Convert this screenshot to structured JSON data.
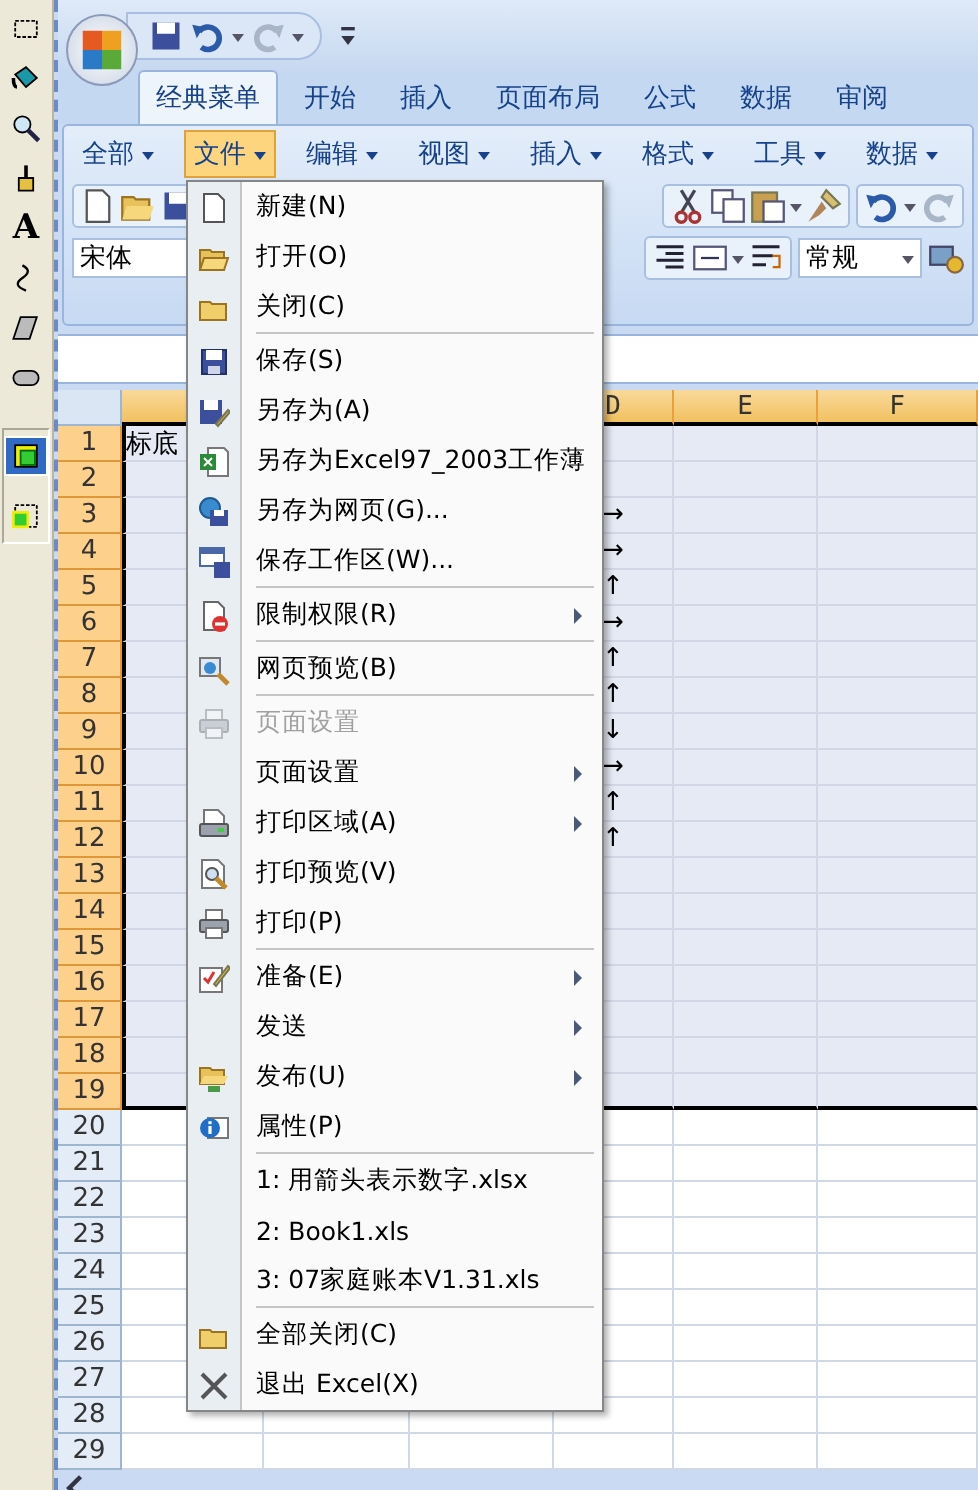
{
  "toolbox": {
    "tools": [
      {
        "kind": "select",
        "selected": false
      },
      {
        "kind": "fill",
        "selected": false
      },
      {
        "kind": "zoom",
        "selected": false
      },
      {
        "kind": "brush",
        "selected": false
      },
      {
        "kind": "text",
        "label": "A",
        "selected": false
      },
      {
        "kind": "curve",
        "selected": false
      },
      {
        "kind": "slant",
        "selected": false
      },
      {
        "kind": "rounded",
        "selected": false
      },
      {
        "kind": "object",
        "selected": true
      },
      {
        "kind": "object-dashed",
        "selected": false
      }
    ]
  },
  "tabs": [
    {
      "label": "经典菜单",
      "selected": true
    },
    {
      "label": "开始",
      "selected": false
    },
    {
      "label": "插入",
      "selected": false
    },
    {
      "label": "页面布局",
      "selected": false
    },
    {
      "label": "公式",
      "selected": false
    },
    {
      "label": "数据",
      "selected": false
    },
    {
      "label": "审阅",
      "selected": false
    }
  ],
  "menubar": [
    {
      "label": "全部",
      "selected": false
    },
    {
      "label": "文件",
      "selected": true
    },
    {
      "label": "编辑",
      "selected": false
    },
    {
      "label": "视图",
      "selected": false
    },
    {
      "label": "插入",
      "selected": false
    },
    {
      "label": "格式",
      "selected": false
    },
    {
      "label": "工具",
      "selected": false
    },
    {
      "label": "数据",
      "selected": false
    }
  ],
  "font_box": {
    "value": "宋体"
  },
  "number_format": {
    "value": "常规"
  },
  "sheet": {
    "columns": [
      {
        "label": "D",
        "selected": true
      },
      {
        "label": "E",
        "selected": true
      },
      {
        "label": "F",
        "selected": true
      }
    ],
    "rows": [
      {
        "number": "1",
        "selected": true,
        "a": "标底"
      },
      {
        "number": "2",
        "selected": true
      },
      {
        "number": "3",
        "selected": true,
        "d": "→"
      },
      {
        "number": "4",
        "selected": true,
        "d": "→"
      },
      {
        "number": "5",
        "selected": true,
        "d": "↑"
      },
      {
        "number": "6",
        "selected": true,
        "d": "→"
      },
      {
        "number": "7",
        "selected": true,
        "d": "↑"
      },
      {
        "number": "8",
        "selected": true,
        "d": "↑"
      },
      {
        "number": "9",
        "selected": true,
        "d": "↓"
      },
      {
        "number": "10",
        "selected": true,
        "d": "→"
      },
      {
        "number": "11",
        "selected": true,
        "d": "↑"
      },
      {
        "number": "12",
        "selected": true,
        "d": "↑"
      },
      {
        "number": "13",
        "selected": true
      },
      {
        "number": "14",
        "selected": true
      },
      {
        "number": "15",
        "selected": true
      },
      {
        "number": "16",
        "selected": true
      },
      {
        "number": "17",
        "selected": true
      },
      {
        "number": "18",
        "selected": true
      },
      {
        "number": "19",
        "selected": true
      },
      {
        "number": "20",
        "selected": false
      },
      {
        "number": "21",
        "selected": false
      },
      {
        "number": "22",
        "selected": false
      },
      {
        "number": "23",
        "selected": false
      },
      {
        "number": "24",
        "selected": false
      },
      {
        "number": "25",
        "selected": false
      },
      {
        "number": "26",
        "selected": false
      },
      {
        "number": "27",
        "selected": false
      },
      {
        "number": "28",
        "selected": false
      },
      {
        "number": "29",
        "selected": false
      }
    ]
  },
  "file_menu": {
    "items": [
      {
        "kind": "document",
        "label": "新建(N)",
        "disabled": false,
        "submenu": false
      },
      {
        "kind": "folder-open",
        "label": "打开(O)",
        "disabled": false,
        "submenu": false
      },
      {
        "kind": "folder",
        "label": "关闭(C)",
        "disabled": false,
        "submenu": false
      },
      {
        "kind": "separator"
      },
      {
        "kind": "floppy",
        "label": "保存(S)",
        "disabled": false,
        "submenu": false
      },
      {
        "kind": "floppy-pen",
        "label": "另存为(A)",
        "disabled": false,
        "submenu": false
      },
      {
        "kind": "sheet-doc",
        "label": "另存为Excel97_2003工作薄",
        "disabled": false,
        "submenu": false
      },
      {
        "kind": "globe-floppy",
        "label": "另存为网页(G)...",
        "disabled": false,
        "submenu": false
      },
      {
        "kind": "window-floppy",
        "label": "保存工作区(W)...",
        "disabled": false,
        "submenu": false
      },
      {
        "kind": "separator"
      },
      {
        "kind": "doc-stop",
        "label": "限制权限(R)",
        "disabled": false,
        "submenu": true
      },
      {
        "kind": "separator"
      },
      {
        "kind": "globe-zoom",
        "label": "网页预览(B)",
        "disabled": false,
        "submenu": false
      },
      {
        "kind": "separator"
      },
      {
        "kind": "printer",
        "label": "页面设置",
        "disabled": true,
        "submenu": false
      },
      {
        "kind": "plain",
        "label": "页面设置",
        "disabled": false,
        "submenu": true
      },
      {
        "kind": "printer-page",
        "label": "打印区域(A)",
        "disabled": false,
        "submenu": true
      },
      {
        "kind": "doc-zoom",
        "label": "打印预览(V)",
        "disabled": false,
        "submenu": false
      },
      {
        "kind": "printer",
        "label": "打印(P)",
        "disabled": false,
        "submenu": false
      },
      {
        "kind": "separator"
      },
      {
        "kind": "pencil-doc",
        "label": "准备(E)",
        "disabled": false,
        "submenu": true
      },
      {
        "kind": "plain",
        "label": "发送",
        "disabled": false,
        "submenu": true
      },
      {
        "kind": "folder-globe",
        "label": "发布(U)",
        "disabled": false,
        "submenu": true
      },
      {
        "kind": "info",
        "label": "属性(P)",
        "disabled": false,
        "submenu": false
      },
      {
        "kind": "separator"
      },
      {
        "kind": "plain",
        "label": "1: 用箭头表示数字.xlsx",
        "disabled": false,
        "submenu": false
      },
      {
        "kind": "plain",
        "label": "2: Book1.xls",
        "disabled": false,
        "submenu": false
      },
      {
        "kind": "plain",
        "label": "3: 07家庭账本V1.31.xls",
        "disabled": false,
        "submenu": false
      },
      {
        "kind": "separator"
      },
      {
        "kind": "folder",
        "label": "全部关闭(C)",
        "disabled": false,
        "submenu": false
      },
      {
        "kind": "cross",
        "label": "退出 Excel(X)",
        "disabled": false,
        "submenu": false
      }
    ]
  }
}
